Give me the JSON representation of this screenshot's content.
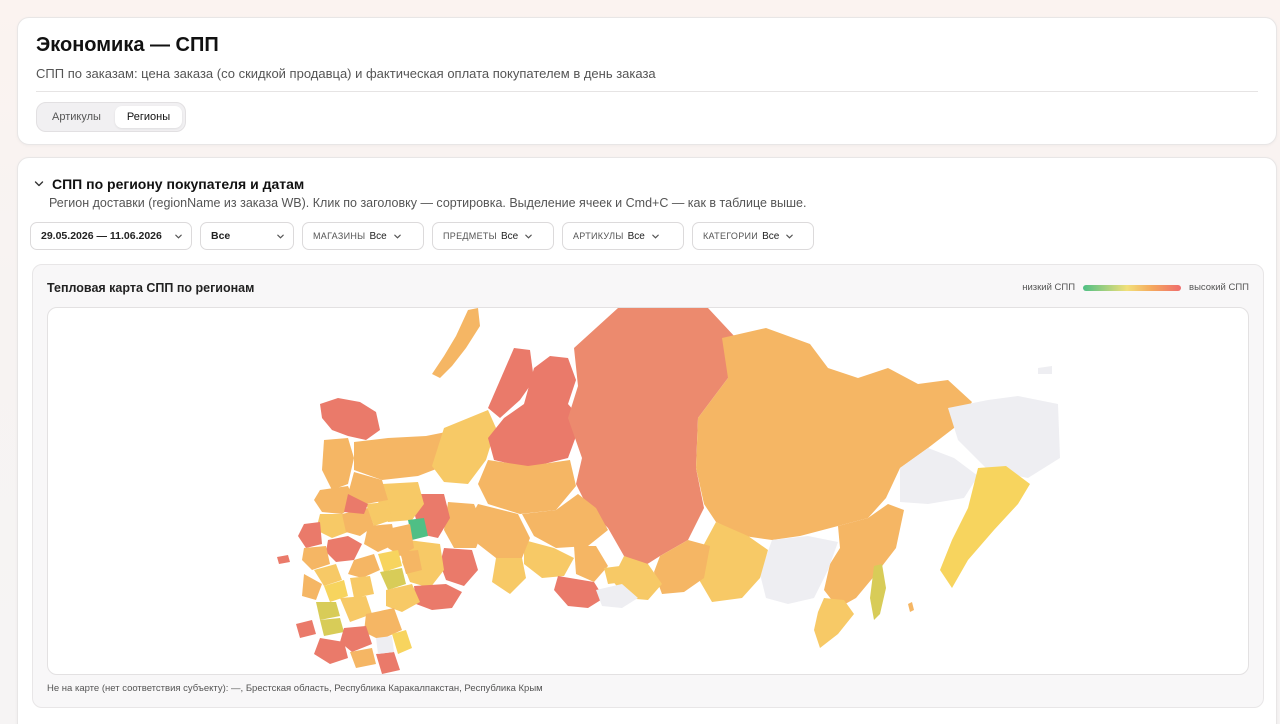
{
  "header": {
    "title": "Экономика — СПП",
    "subtitle": "СПП по заказам: цена заказа (со скидкой продавца) и фактическая оплата покупателем в день заказа",
    "tabs": [
      {
        "label": "Артикулы",
        "active": false
      },
      {
        "label": "Регионы",
        "active": true
      }
    ]
  },
  "section": {
    "title": "СПП по региону покупателя и датам",
    "subtitle": "Регион доставки (regionName из заказа WB). Клик по заголовку — сортировка. Выделение ячеек и Cmd+C — как в таблице выше.",
    "filters": {
      "date_range": "29.05.2026 — 11.06.2026",
      "status": "Все",
      "shops_label": "МАГАЗИНЫ",
      "shops_value": "Все",
      "subjects_label": "ПРЕДМЕТЫ",
      "subjects_value": "Все",
      "articles_label": "АРТИКУЛЫ",
      "articles_value": "Все",
      "categories_label": "КАТЕГОРИИ",
      "categories_value": "Все"
    }
  },
  "map": {
    "title": "Тепловая карта СПП по регионам",
    "legend_low": "низкий СПП",
    "legend_high": "высокий СПП",
    "note": "Не на карте (нет соответствия субъекту): —, Брестская область, Республика Каракалпакстан, Республика Крым",
    "colors": {
      "low": "#4fbf85",
      "mid": "#f2e07a",
      "midhigh": "#f5b664",
      "high": "#ea7a6a",
      "nodata": "#eeeef2"
    }
  }
}
